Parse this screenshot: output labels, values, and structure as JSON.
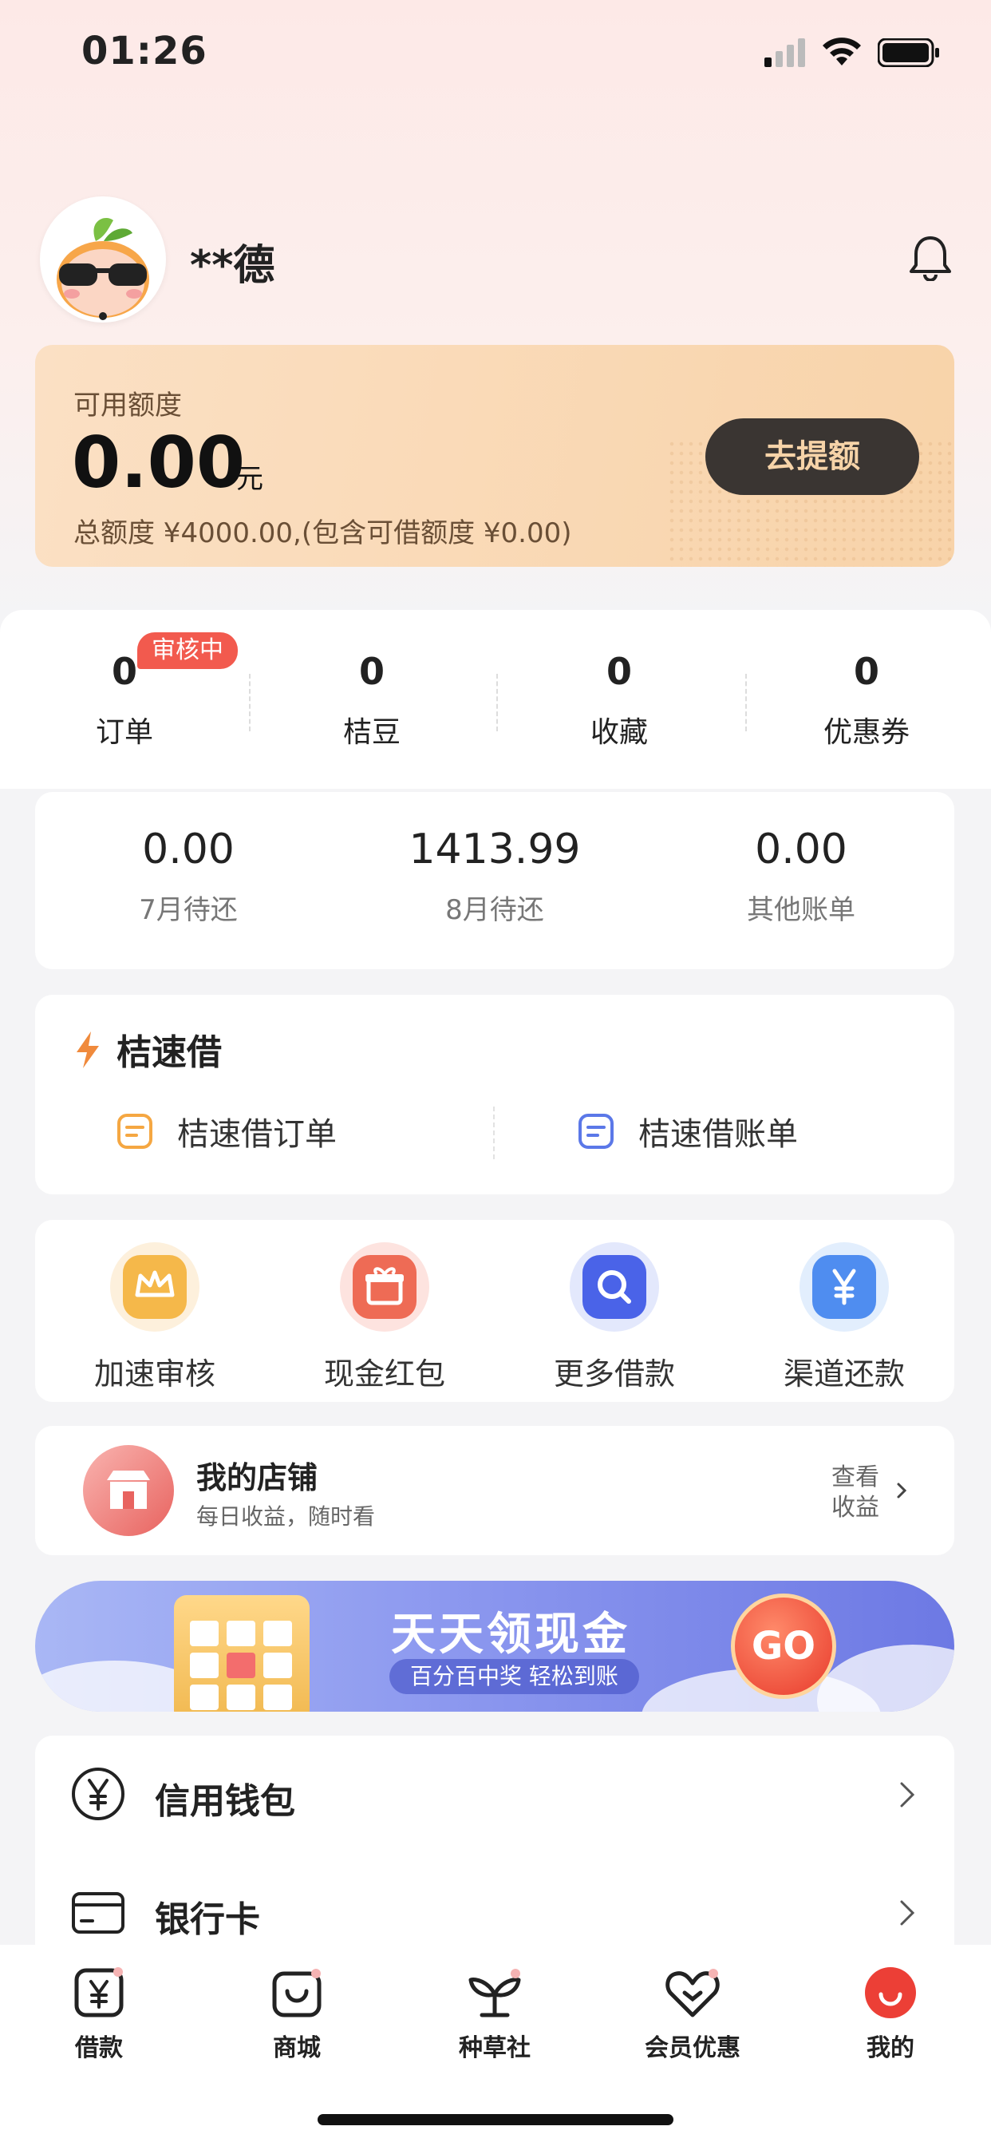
{
  "status_bar": {
    "time": "01:26"
  },
  "profile": {
    "name": "**德"
  },
  "credit": {
    "label": "可用额度",
    "amount": "0.00",
    "unit": "元",
    "total_text": "总额度 ¥4000.00,(包含可借额度 ¥0.00)",
    "button": "去提额"
  },
  "stats": {
    "badge": "审核中",
    "items": [
      {
        "value": "0",
        "label": "订单"
      },
      {
        "value": "0",
        "label": "桔豆"
      },
      {
        "value": "0",
        "label": "收藏"
      },
      {
        "value": "0",
        "label": "优惠券"
      }
    ]
  },
  "bills": [
    {
      "value": "0.00",
      "label": "7月待还"
    },
    {
      "value": "1413.99",
      "label": "8月待还"
    },
    {
      "value": "0.00",
      "label": "其他账单"
    }
  ],
  "jsj": {
    "title": "桔速借",
    "order": "桔速借订单",
    "bill": "桔速借账单"
  },
  "quick_actions": [
    {
      "label": "加速审核",
      "icon": "crown-icon",
      "color": "#f5b84a"
    },
    {
      "label": "现金红包",
      "icon": "gift-icon",
      "color": "#ee6b55"
    },
    {
      "label": "更多借款",
      "icon": "search-icon",
      "color": "#4a63e8"
    },
    {
      "label": "渠道还款",
      "icon": "yen-icon",
      "color": "#4f8df0"
    }
  ],
  "shop": {
    "title": "我的店铺",
    "subtitle": "每日收益，随时看",
    "link_line1": "查看",
    "link_line2": "收益"
  },
  "banner": {
    "headline": "天天领现金",
    "sub": "百分百中奖 轻松到账",
    "go": "GO"
  },
  "menu": [
    {
      "label": "信用钱包",
      "icon": "yen-circle-icon"
    },
    {
      "label": "银行卡",
      "icon": "card-icon"
    }
  ],
  "tabs": [
    {
      "label": "借款",
      "icon": "loan-icon"
    },
    {
      "label": "商城",
      "icon": "bag-icon"
    },
    {
      "label": "种草社",
      "icon": "sprout-icon"
    },
    {
      "label": "会员优惠",
      "icon": "heart-icon"
    },
    {
      "label": "我的",
      "icon": "profile-icon",
      "active": true
    }
  ]
}
